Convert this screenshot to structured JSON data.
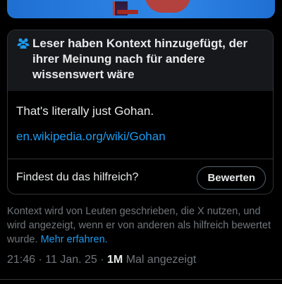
{
  "note": {
    "title": "Leser haben Kontext hinzugefügt, der ihrer Meinung nach für andere wissenswert wäre",
    "text": "That's literally just Gohan.",
    "link": "en.wikipedia.org/wiki/Gohan",
    "helpful_question": "Findest du das hilfreich?",
    "rate_label": "Bewerten"
  },
  "footnote": {
    "text": "Kontext wird von Leuten geschrieben, die X nutzen, und wird angezeigt, wenn er von anderen als hilfreich bewertet wurde.",
    "more_link": "Mehr erfahren."
  },
  "meta": {
    "timestamp": "21:46 · 11 Jan. 25 · ",
    "views": "1M",
    "views_suffix": " Mal angezeigt"
  },
  "colors": {
    "accent": "#1d9bf0",
    "background": "#000000",
    "card_header": "#16181c",
    "secondary_text": "#71767b"
  },
  "icons": {
    "note_icon": "people-icon"
  }
}
